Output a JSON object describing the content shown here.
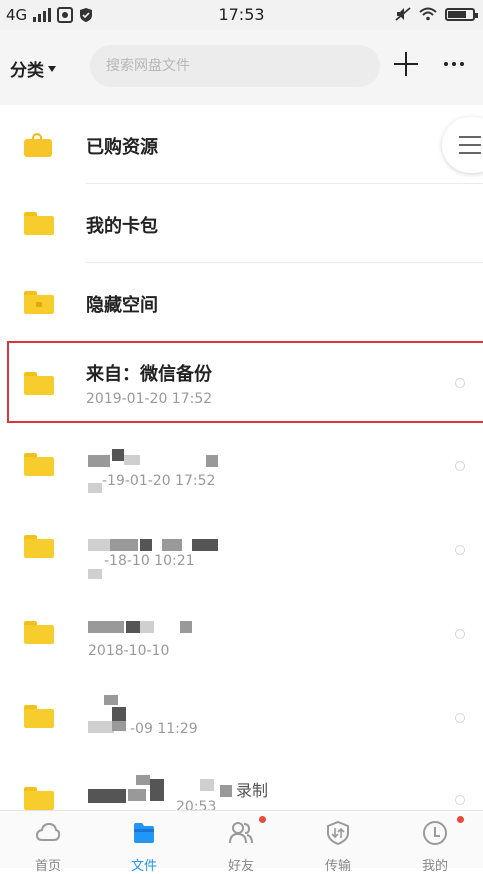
{
  "status_bar": {
    "network": "4G",
    "time": "17:53"
  },
  "toolbar": {
    "category_label": "分类",
    "search_placeholder": "搜索网盘文件"
  },
  "files": [
    {
      "name": "已购资源",
      "subtitle": "",
      "icon": "shopping-bag-icon"
    },
    {
      "name": "我的卡包",
      "subtitle": "",
      "icon": "folder-icon"
    },
    {
      "name": "隐藏空间",
      "subtitle": "",
      "icon": "folder-icon"
    },
    {
      "name": "来自：微信备份",
      "subtitle": "2019-01-20  17:52",
      "icon": "folder-icon",
      "highlighted": true
    },
    {
      "name": "",
      "subtitle": "-19-01-20  17:52",
      "icon": "folder-icon",
      "obscured": true
    },
    {
      "name": "",
      "subtitle": "-18-10  10:21",
      "icon": "folder-icon",
      "obscured": true
    },
    {
      "name": "",
      "subtitle": "2018-10-10",
      "icon": "folder-icon",
      "obscured": true
    },
    {
      "name": "",
      "subtitle": "-09  11:29",
      "icon": "folder-icon",
      "obscured": true
    },
    {
      "name": "录制",
      "subtitle": "20:53",
      "icon": "folder-icon",
      "obscured": true
    }
  ],
  "tabbar": [
    {
      "label": "首页",
      "icon": "cloud-icon",
      "active": false
    },
    {
      "label": "文件",
      "icon": "file-icon",
      "active": true
    },
    {
      "label": "好友",
      "icon": "friends-icon",
      "active": false,
      "badge": true
    },
    {
      "label": "传输",
      "icon": "transfer-icon",
      "active": false
    },
    {
      "label": "我的",
      "icon": "profile-icon",
      "active": false,
      "badge": true
    }
  ],
  "colors": {
    "accent": "#2196f3",
    "folder": "#f7cd2e",
    "highlight_border": "#d9373f",
    "badge": "#e84b3c"
  }
}
